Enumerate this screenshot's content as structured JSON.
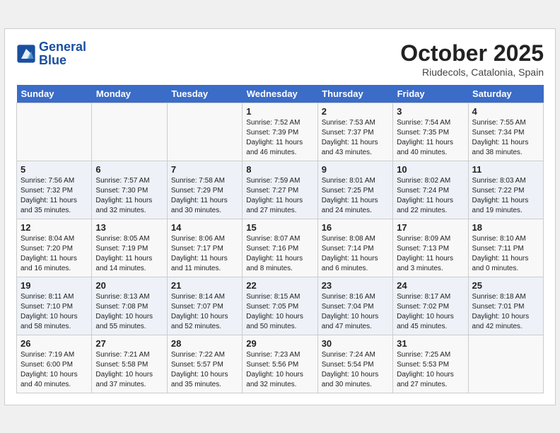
{
  "header": {
    "logo_line1": "General",
    "logo_line2": "Blue",
    "month": "October 2025",
    "location": "Riudecols, Catalonia, Spain"
  },
  "weekdays": [
    "Sunday",
    "Monday",
    "Tuesday",
    "Wednesday",
    "Thursday",
    "Friday",
    "Saturday"
  ],
  "weeks": [
    [
      {
        "day": "",
        "text": ""
      },
      {
        "day": "",
        "text": ""
      },
      {
        "day": "",
        "text": ""
      },
      {
        "day": "1",
        "text": "Sunrise: 7:52 AM\nSunset: 7:39 PM\nDaylight: 11 hours and 46 minutes."
      },
      {
        "day": "2",
        "text": "Sunrise: 7:53 AM\nSunset: 7:37 PM\nDaylight: 11 hours and 43 minutes."
      },
      {
        "day": "3",
        "text": "Sunrise: 7:54 AM\nSunset: 7:35 PM\nDaylight: 11 hours and 40 minutes."
      },
      {
        "day": "4",
        "text": "Sunrise: 7:55 AM\nSunset: 7:34 PM\nDaylight: 11 hours and 38 minutes."
      }
    ],
    [
      {
        "day": "5",
        "text": "Sunrise: 7:56 AM\nSunset: 7:32 PM\nDaylight: 11 hours and 35 minutes."
      },
      {
        "day": "6",
        "text": "Sunrise: 7:57 AM\nSunset: 7:30 PM\nDaylight: 11 hours and 32 minutes."
      },
      {
        "day": "7",
        "text": "Sunrise: 7:58 AM\nSunset: 7:29 PM\nDaylight: 11 hours and 30 minutes."
      },
      {
        "day": "8",
        "text": "Sunrise: 7:59 AM\nSunset: 7:27 PM\nDaylight: 11 hours and 27 minutes."
      },
      {
        "day": "9",
        "text": "Sunrise: 8:01 AM\nSunset: 7:25 PM\nDaylight: 11 hours and 24 minutes."
      },
      {
        "day": "10",
        "text": "Sunrise: 8:02 AM\nSunset: 7:24 PM\nDaylight: 11 hours and 22 minutes."
      },
      {
        "day": "11",
        "text": "Sunrise: 8:03 AM\nSunset: 7:22 PM\nDaylight: 11 hours and 19 minutes."
      }
    ],
    [
      {
        "day": "12",
        "text": "Sunrise: 8:04 AM\nSunset: 7:20 PM\nDaylight: 11 hours and 16 minutes."
      },
      {
        "day": "13",
        "text": "Sunrise: 8:05 AM\nSunset: 7:19 PM\nDaylight: 11 hours and 14 minutes."
      },
      {
        "day": "14",
        "text": "Sunrise: 8:06 AM\nSunset: 7:17 PM\nDaylight: 11 hours and 11 minutes."
      },
      {
        "day": "15",
        "text": "Sunrise: 8:07 AM\nSunset: 7:16 PM\nDaylight: 11 hours and 8 minutes."
      },
      {
        "day": "16",
        "text": "Sunrise: 8:08 AM\nSunset: 7:14 PM\nDaylight: 11 hours and 6 minutes."
      },
      {
        "day": "17",
        "text": "Sunrise: 8:09 AM\nSunset: 7:13 PM\nDaylight: 11 hours and 3 minutes."
      },
      {
        "day": "18",
        "text": "Sunrise: 8:10 AM\nSunset: 7:11 PM\nDaylight: 11 hours and 0 minutes."
      }
    ],
    [
      {
        "day": "19",
        "text": "Sunrise: 8:11 AM\nSunset: 7:10 PM\nDaylight: 10 hours and 58 minutes."
      },
      {
        "day": "20",
        "text": "Sunrise: 8:13 AM\nSunset: 7:08 PM\nDaylight: 10 hours and 55 minutes."
      },
      {
        "day": "21",
        "text": "Sunrise: 8:14 AM\nSunset: 7:07 PM\nDaylight: 10 hours and 52 minutes."
      },
      {
        "day": "22",
        "text": "Sunrise: 8:15 AM\nSunset: 7:05 PM\nDaylight: 10 hours and 50 minutes."
      },
      {
        "day": "23",
        "text": "Sunrise: 8:16 AM\nSunset: 7:04 PM\nDaylight: 10 hours and 47 minutes."
      },
      {
        "day": "24",
        "text": "Sunrise: 8:17 AM\nSunset: 7:02 PM\nDaylight: 10 hours and 45 minutes."
      },
      {
        "day": "25",
        "text": "Sunrise: 8:18 AM\nSunset: 7:01 PM\nDaylight: 10 hours and 42 minutes."
      }
    ],
    [
      {
        "day": "26",
        "text": "Sunrise: 7:19 AM\nSunset: 6:00 PM\nDaylight: 10 hours and 40 minutes."
      },
      {
        "day": "27",
        "text": "Sunrise: 7:21 AM\nSunset: 5:58 PM\nDaylight: 10 hours and 37 minutes."
      },
      {
        "day": "28",
        "text": "Sunrise: 7:22 AM\nSunset: 5:57 PM\nDaylight: 10 hours and 35 minutes."
      },
      {
        "day": "29",
        "text": "Sunrise: 7:23 AM\nSunset: 5:56 PM\nDaylight: 10 hours and 32 minutes."
      },
      {
        "day": "30",
        "text": "Sunrise: 7:24 AM\nSunset: 5:54 PM\nDaylight: 10 hours and 30 minutes."
      },
      {
        "day": "31",
        "text": "Sunrise: 7:25 AM\nSunset: 5:53 PM\nDaylight: 10 hours and 27 minutes."
      },
      {
        "day": "",
        "text": ""
      }
    ]
  ]
}
